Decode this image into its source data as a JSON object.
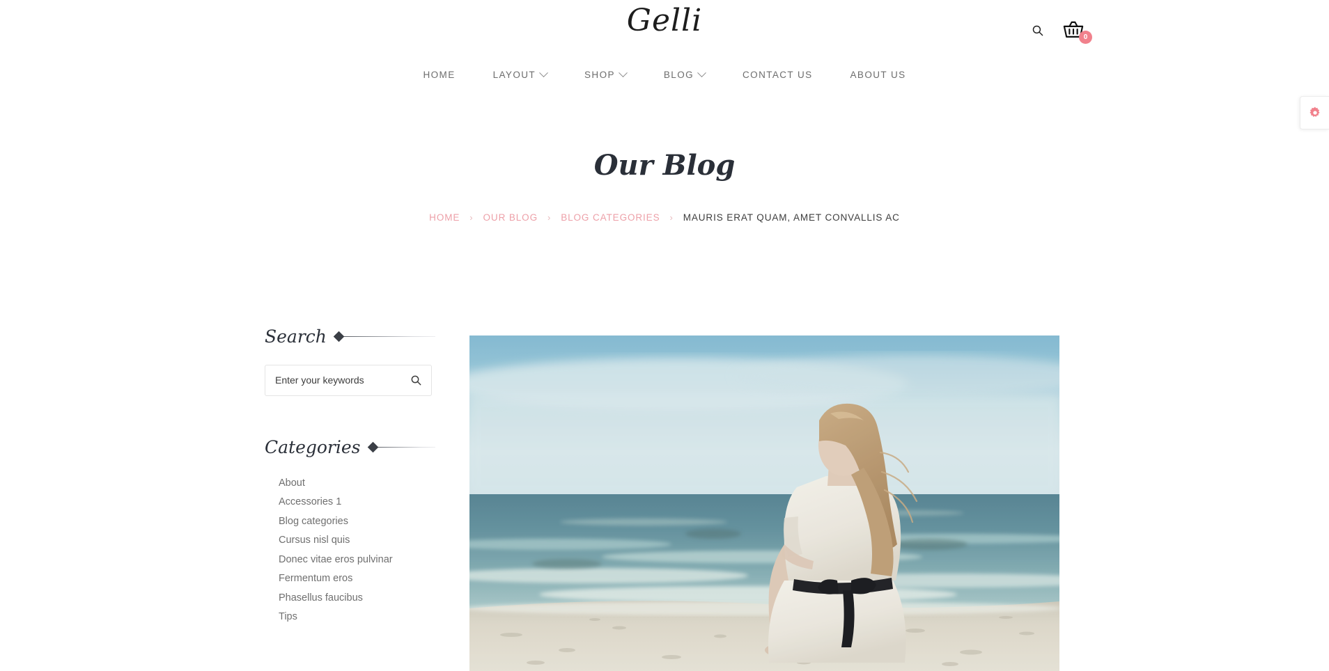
{
  "site": {
    "logo_text": "Gelli",
    "background": "#ffffff",
    "accent_pink": "#f1818c",
    "breadcrumb_link_color": "#eda0a8"
  },
  "header": {
    "search_icon": "search-icon",
    "cart_icon": "shopping-basket-icon",
    "cart_count": "0"
  },
  "nav": {
    "items": [
      {
        "label": "HOME",
        "has_dropdown": false
      },
      {
        "label": "LAYOUT",
        "has_dropdown": true
      },
      {
        "label": "SHOP",
        "has_dropdown": true
      },
      {
        "label": "BLOG",
        "has_dropdown": true
      },
      {
        "label": "CONTACT US",
        "has_dropdown": false
      },
      {
        "label": "ABOUT US",
        "has_dropdown": false
      }
    ]
  },
  "page": {
    "title": "Our Blog",
    "breadcrumb": {
      "links": [
        {
          "label": "HOME"
        },
        {
          "label": "OUR BLOG"
        },
        {
          "label": "BLOG CATEGORIES"
        }
      ],
      "separator": "›",
      "current": "MAURIS ERAT QUAM, AMET CONVALLIS AC"
    }
  },
  "sidebar": {
    "search_widget": {
      "title": "Search",
      "placeholder": "Enter your keywords",
      "value": "",
      "submit_icon": "search-icon"
    },
    "categories_widget": {
      "title": "Categories",
      "items": [
        {
          "label": "About"
        },
        {
          "label": "Accessories 1"
        },
        {
          "label": "Blog categories"
        },
        {
          "label": "Cursus nisl quis"
        },
        {
          "label": "Donec vitae eros pulvinar"
        },
        {
          "label": "Fermentum eros"
        },
        {
          "label": "Phasellus faucibus"
        },
        {
          "label": "Tips"
        }
      ]
    }
  },
  "post": {
    "featured_image_alt": "Woman in a white dress sitting on a sandy beach looking out at the sea"
  },
  "settings_tab": {
    "icon": "gear-icon"
  }
}
